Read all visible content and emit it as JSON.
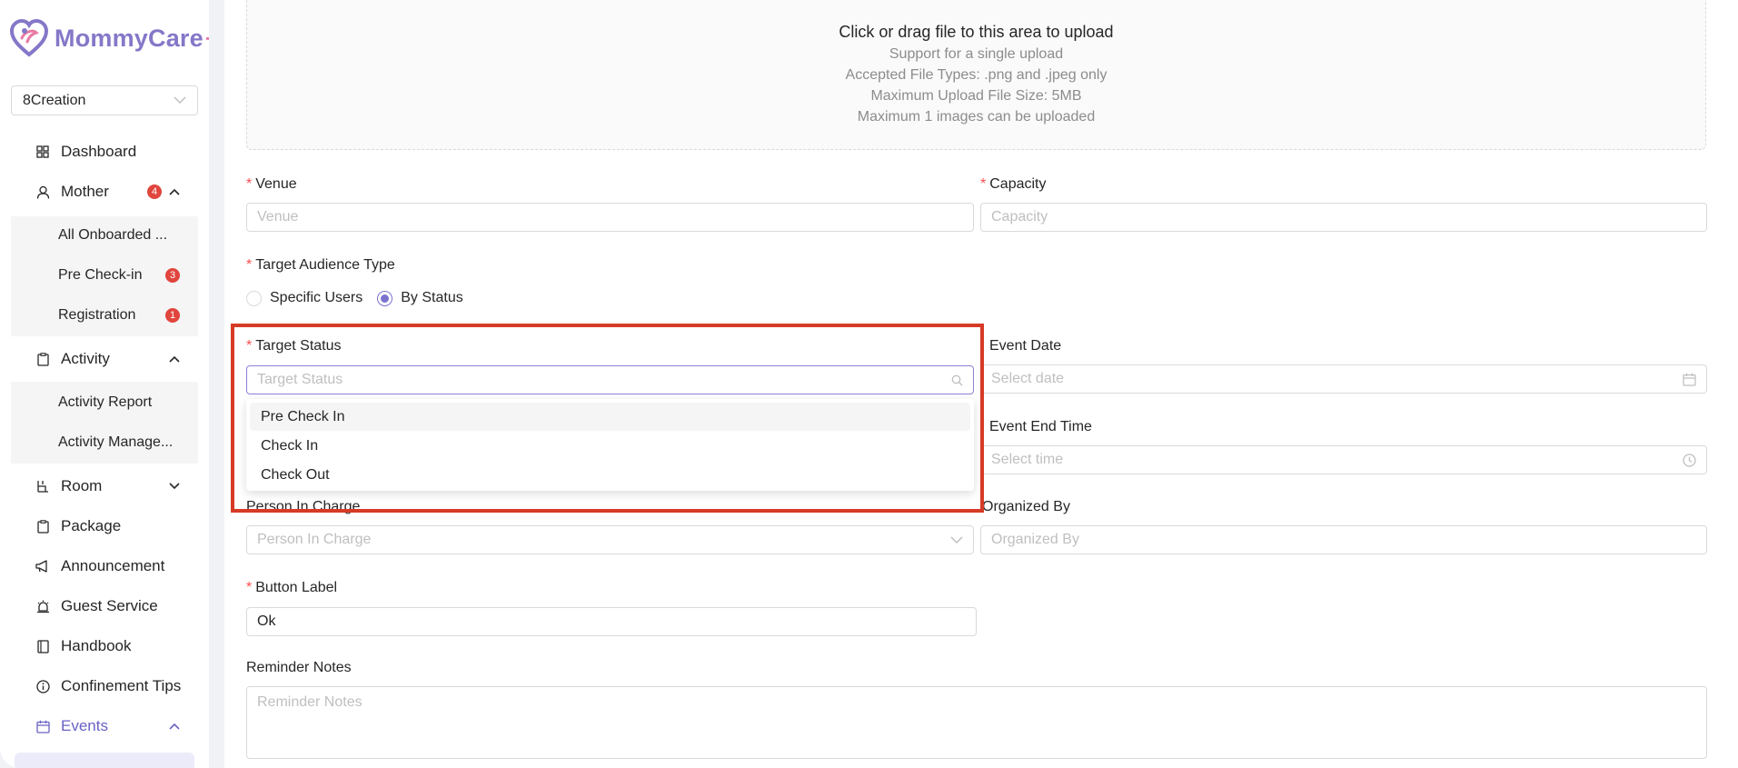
{
  "app": {
    "name": "MommyCare",
    "name_suffix": "+"
  },
  "org_select": {
    "value": "8Creation"
  },
  "sidebar": {
    "items": [
      {
        "label": "Dashboard"
      },
      {
        "label": "Mother",
        "badge": "4"
      },
      {
        "label": "All Onboarded ..."
      },
      {
        "label": "Pre Check-in",
        "badge": "3"
      },
      {
        "label": "Registration",
        "badge": "1"
      },
      {
        "label": "Activity"
      },
      {
        "label": "Activity Report"
      },
      {
        "label": "Activity Manage..."
      },
      {
        "label": "Room"
      },
      {
        "label": "Package"
      },
      {
        "label": "Announcement"
      },
      {
        "label": "Guest Service"
      },
      {
        "label": "Handbook"
      },
      {
        "label": "Confinement Tips"
      },
      {
        "label": "Events"
      }
    ]
  },
  "upload": {
    "title": "Click or drag file to this area to upload",
    "lines": [
      "Support for a single upload",
      "Accepted File Types: .png and .jpeg only",
      "Maximum Upload File Size: 5MB",
      "Maximum 1 images can be uploaded"
    ]
  },
  "form": {
    "venue": {
      "label": "Venue",
      "placeholder": "Venue"
    },
    "capacity": {
      "label": "Capacity",
      "placeholder": "Capacity"
    },
    "target_audience_type": {
      "label": "Target Audience Type",
      "options": [
        "Specific Users",
        "By Status"
      ],
      "selected": "By Status"
    },
    "target_status": {
      "label": "Target Status",
      "placeholder": "Target Status",
      "options": [
        "Pre Check In",
        "Check In",
        "Check Out"
      ]
    },
    "event_date": {
      "label": "Event Date",
      "placeholder": "Select date"
    },
    "event_end_time": {
      "label": "Event End Time",
      "placeholder": "Select time"
    },
    "person_in_charge": {
      "label": "Person In Charge",
      "placeholder": "Person In Charge"
    },
    "organized_by": {
      "label": "Organized By",
      "placeholder": "Organized By"
    },
    "button_label": {
      "label": "Button Label",
      "value": "Ok"
    },
    "reminder_notes": {
      "label": "Reminder Notes",
      "placeholder": "Reminder Notes"
    }
  },
  "colors": {
    "brand": "#8577c8",
    "accent_pink": "#e97aa4",
    "badge": "#e0463d",
    "highlight": "#d63b25",
    "required": "#ff4d4f"
  },
  "icons": [
    "logo-heart-icon",
    "chevron-down-icon",
    "dashboard-icon",
    "user-icon",
    "clipboard-icon",
    "room-icon",
    "package-icon",
    "megaphone-icon",
    "bell-icon",
    "book-icon",
    "info-icon",
    "calendar-icon",
    "search-icon",
    "clock-icon"
  ]
}
